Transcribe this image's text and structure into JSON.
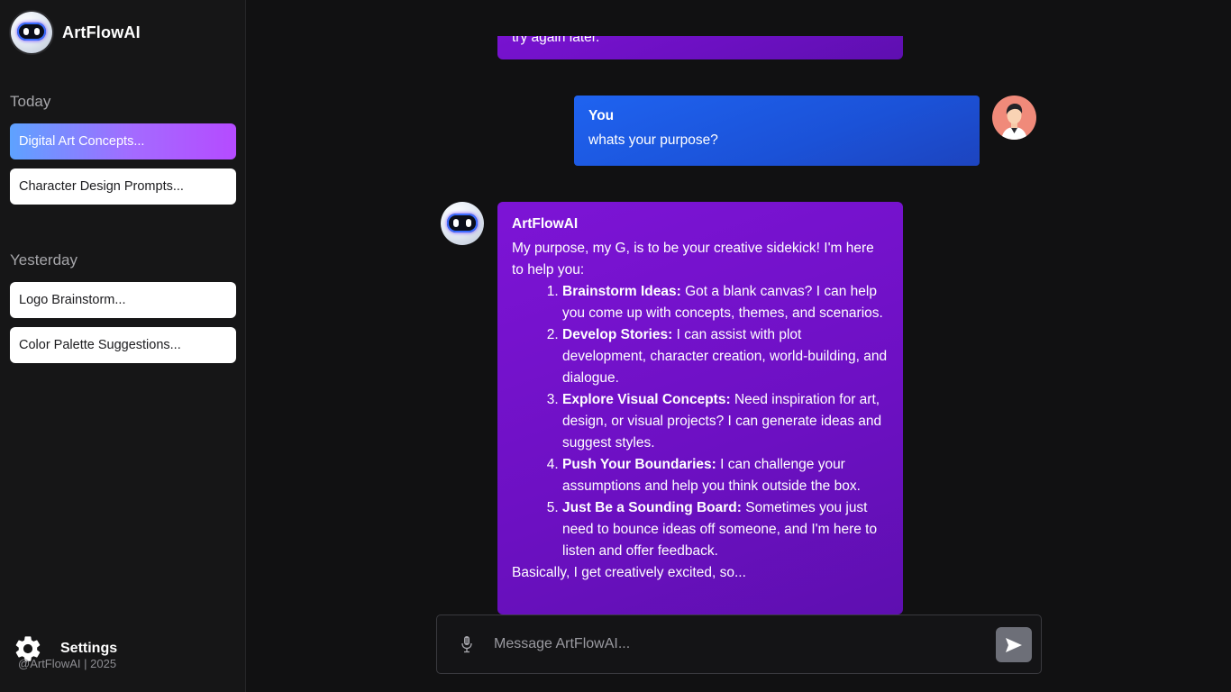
{
  "app": {
    "name": "ArtFlowAI"
  },
  "sidebar": {
    "sections": [
      {
        "label": "Today",
        "items": [
          {
            "label": "Digital Art Concepts...",
            "active": true
          },
          {
            "label": "Character Design Prompts...",
            "active": false
          }
        ]
      },
      {
        "label": "Yesterday",
        "items": [
          {
            "label": "Logo Brainstorm...",
            "active": false
          },
          {
            "label": "Color Palette Suggestions...",
            "active": false
          }
        ]
      }
    ],
    "settings_label": "Settings",
    "footer": "@ArtFlowAI | 2025"
  },
  "chat": {
    "prev_ai_tail": "try again later.",
    "user_msg": {
      "sender": "You",
      "text": "whats your purpose?"
    },
    "ai_msg": {
      "sender": "ArtFlowAI",
      "intro": "My purpose, my G, is to be your creative sidekick! I'm here to help you:",
      "items": [
        {
          "title": "Brainstorm Ideas:",
          "text": " Got a blank canvas? I can help you come up with concepts, themes, and scenarios."
        },
        {
          "title": "Develop Stories:",
          "text": " I can assist with plot development, character creation, world-building, and dialogue."
        },
        {
          "title": "Explore Visual Concepts:",
          "text": " Need inspiration for art, design, or visual projects? I can generate ideas and suggest styles."
        },
        {
          "title": "Push Your Boundaries:",
          "text": " I can challenge your assumptions and help you think outside the box."
        },
        {
          "title": "Just Be a Sounding Board:",
          "text": " Sometimes you just need to bounce ideas off someone, and I'm here to listen and offer feedback."
        }
      ],
      "outro": "Basically, I get creatively excited, so..."
    }
  },
  "composer": {
    "placeholder": "Message ArtFlowAI..."
  },
  "icons": {
    "logo": "robot-logo-icon",
    "gear": "gear-icon",
    "mic": "microphone-icon",
    "send": "send-arrow-icon",
    "user_avatar": "user-avatar-icon"
  },
  "colors": {
    "ai_bubble": "#7d14d6",
    "user_bubble": "#1f63f0",
    "active_item_start": "#5ea2ff",
    "active_item_end": "#b54bff",
    "send_button": "#6d6f78"
  }
}
